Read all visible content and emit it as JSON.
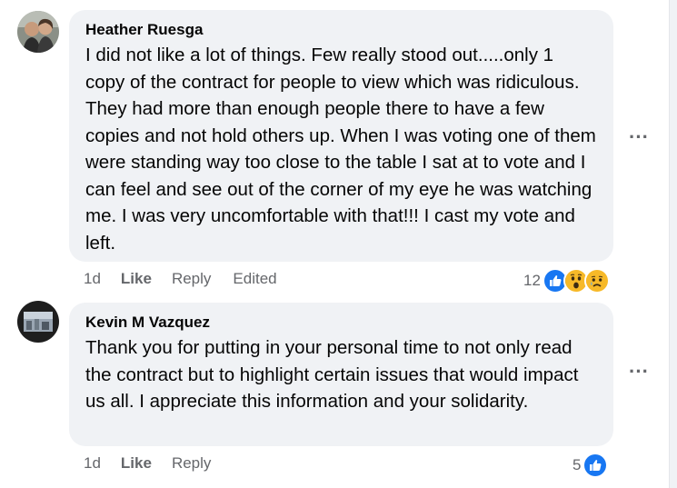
{
  "comments": [
    {
      "author": "Heather Ruesga",
      "text": "I did not like a lot of things. Few really stood out.....only 1 copy of the contract for people to view which was ridiculous. They had more than enough people there to have a few copies and not hold others up. When I was voting one of them were standing way too close to the table I sat at to vote and I can feel and see out of the corner of my eye he was watching me. I was very uncomfortable with that!!! I cast my vote and left.",
      "time": "1d",
      "like_label": "Like",
      "reply_label": "Reply",
      "edited_label": "Edited",
      "reaction_count": "12",
      "reaction_icons": [
        "like-icon",
        "wow-icon",
        "sad-icon"
      ]
    },
    {
      "author": "Kevin M Vazquez",
      "text": "Thank you for putting in your personal time to not only read the contract but to highlight certain issues that would impact us all. I appreciate this information and your solidarity.",
      "time": "1d",
      "like_label": "Like",
      "reply_label": "Reply",
      "reaction_count": "5",
      "reaction_icons": [
        "like-icon"
      ]
    }
  ],
  "more_label": "···",
  "colors": {
    "bubble": "#f0f2f5",
    "secondary_text": "#65676b",
    "like_blue": "#1877f2",
    "emoji_yellow": "#f7b928"
  }
}
